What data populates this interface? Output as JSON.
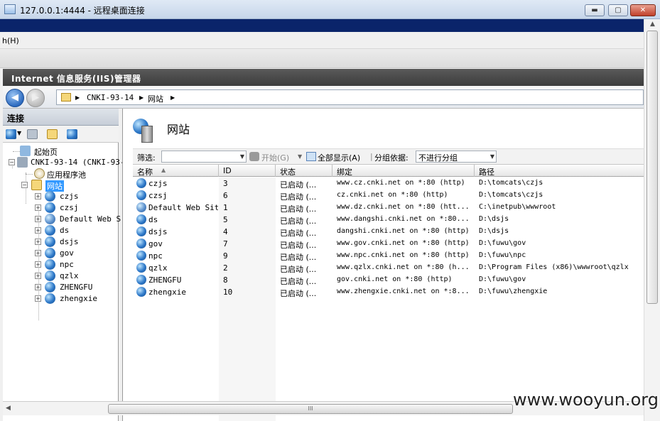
{
  "window": {
    "title": "127.0.0.1:4444 - 远程桌面连接",
    "controls": {
      "minimize": "▬",
      "maximize": "▢",
      "close": "✕"
    }
  },
  "menu": {
    "partial_item": "h(H)"
  },
  "iis": {
    "title": "Internet 信息服务(IIS)管理器",
    "breadcrumb": [
      "CNKI-93-14",
      "网站"
    ]
  },
  "connections": {
    "header": "连接",
    "tree": {
      "start_page": "起始页",
      "server": "CNKI-93-14 (CNKI-93-",
      "app_pools": "应用程序池",
      "sites_node": "网站",
      "sites": [
        "czjs",
        "czsj",
        "Default Web S:",
        "ds",
        "dsjs",
        "gov",
        "npc",
        "qzlx",
        "ZHENGFU",
        "zhengxie"
      ]
    }
  },
  "main": {
    "title": "网站",
    "filter": {
      "label": "筛选:",
      "input_value": "",
      "start_button": "开始(G)",
      "show_all_button": "全部显示(A)",
      "group_label": "分组依据:",
      "group_value": "不进行分组"
    },
    "columns": [
      "名称",
      "ID",
      "状态",
      "绑定",
      "路径"
    ],
    "rows": [
      {
        "name": "czjs",
        "id": "3",
        "status": "已启动 (...",
        "binding": "www.cz.cnki.net on *:80 (http)",
        "path": "D:\\tomcats\\czjs"
      },
      {
        "name": "czsj",
        "id": "6",
        "status": "已启动 (...",
        "binding": "cz.cnki.net on *:80 (http)",
        "path": "D:\\tomcats\\czjs"
      },
      {
        "name": "Default Web Site",
        "id": "1",
        "status": "已启动 (...",
        "binding": "www.dz.cnki.net on *:80 (htt...",
        "path": "C:\\inetpub\\wwwroot"
      },
      {
        "name": "ds",
        "id": "5",
        "status": "已启动 (...",
        "binding": "www.dangshi.cnki.net on *:80...",
        "path": "D:\\dsjs"
      },
      {
        "name": "dsjs",
        "id": "4",
        "status": "已启动 (...",
        "binding": "dangshi.cnki.net on *:80 (http)",
        "path": "D:\\dsjs"
      },
      {
        "name": "gov",
        "id": "7",
        "status": "已启动 (...",
        "binding": "www.gov.cnki.net on *:80 (http)",
        "path": "D:\\fuwu\\gov"
      },
      {
        "name": "npc",
        "id": "9",
        "status": "已启动 (...",
        "binding": "www.npc.cnki.net on *:80 (http)",
        "path": "D:\\fuwu\\npc"
      },
      {
        "name": "qzlx",
        "id": "2",
        "status": "已启动 (...",
        "binding": "www.qzlx.cnki.net on *:80 (h...",
        "path": "D:\\Program Files (x86)\\wwwroot\\qzlx"
      },
      {
        "name": "ZHENGFU",
        "id": "8",
        "status": "已启动 (...",
        "binding": "gov.cnki.net on *:80 (http)",
        "path": "D:\\fuwu\\gov"
      },
      {
        "name": "zhengxie",
        "id": "10",
        "status": "已启动 (...",
        "binding": "www.zhengxie.cnki.net on *:8...",
        "path": "D:\\fuwu\\zhengxie"
      }
    ]
  },
  "scrollbar": {
    "grip": "III"
  },
  "watermark": "www.wooyun.org"
}
